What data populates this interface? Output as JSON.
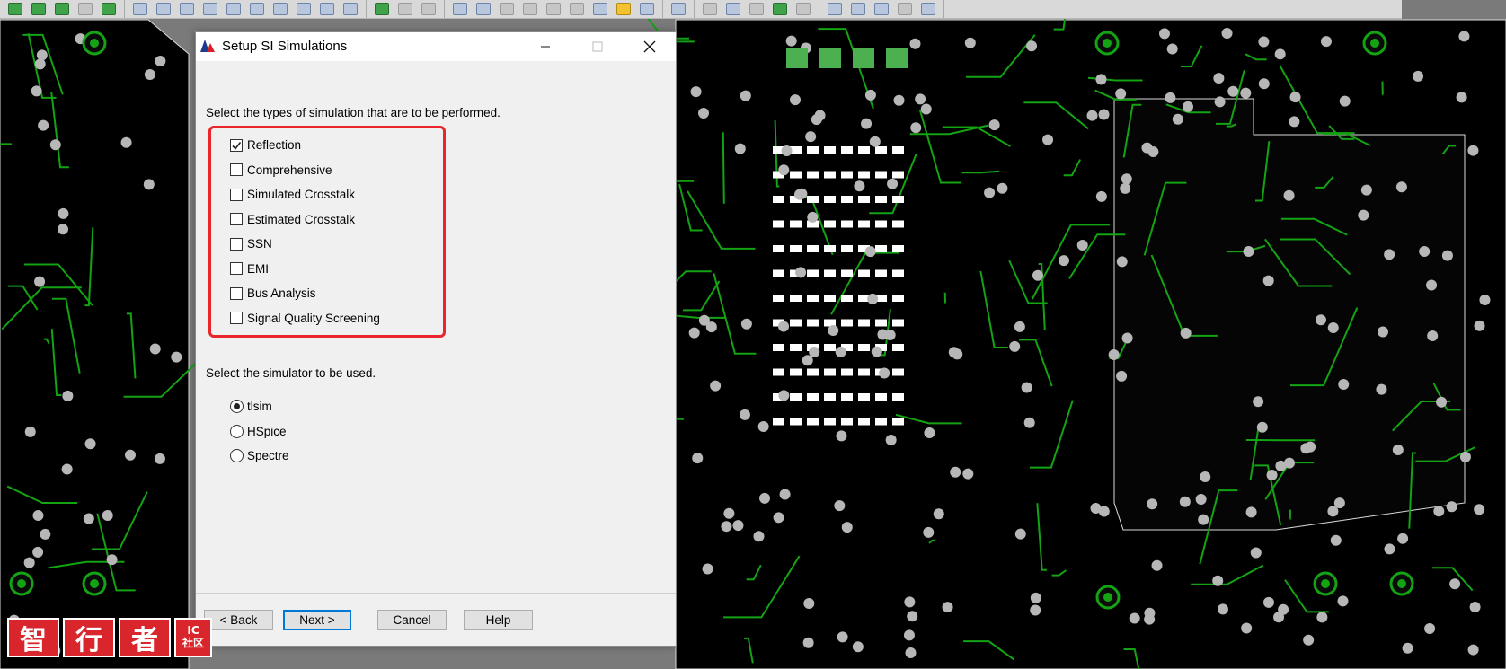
{
  "toolbar": {
    "icons": [
      "grid-icon",
      "layer-icon",
      "zoom-icon",
      "undo-icon",
      "redo-icon",
      "select-icon",
      "route-icon",
      "via-icon",
      "text-icon",
      "shape-icon",
      "measure-icon",
      "signal-icon",
      "probe-icon",
      "lock-icon",
      "report-icon",
      "help-icon"
    ]
  },
  "dialog": {
    "title": "Setup SI Simulations",
    "types_prompt": "Select the types of simulation that are to be performed.",
    "simulation_types": [
      {
        "label": "Reflection",
        "checked": true
      },
      {
        "label": "Comprehensive",
        "checked": false
      },
      {
        "label": "Simulated Crosstalk",
        "checked": false
      },
      {
        "label": "Estimated Crosstalk",
        "checked": false
      },
      {
        "label": "SSN",
        "checked": false
      },
      {
        "label": "EMI",
        "checked": false
      },
      {
        "label": "Bus Analysis",
        "checked": false
      },
      {
        "label": "Signal Quality Screening",
        "checked": false
      }
    ],
    "simulator_prompt": "Select the simulator to be used.",
    "simulators": [
      {
        "label": "tlsim",
        "selected": true
      },
      {
        "label": "HSpice",
        "selected": false
      },
      {
        "label": "Spectre",
        "selected": false
      }
    ],
    "buttons": {
      "back": "< Back",
      "next": "Next >",
      "cancel": "Cancel",
      "help": "Help"
    },
    "highlight_color": "#e8262b"
  },
  "watermark": {
    "chars": [
      "智",
      "行",
      "者"
    ],
    "badge_top": "IC",
    "badge_bottom": "社区"
  },
  "colors": {
    "board": "#000000",
    "trace": "#13a313",
    "pad": "#b7b7b7",
    "background": "#7a7a7a"
  }
}
